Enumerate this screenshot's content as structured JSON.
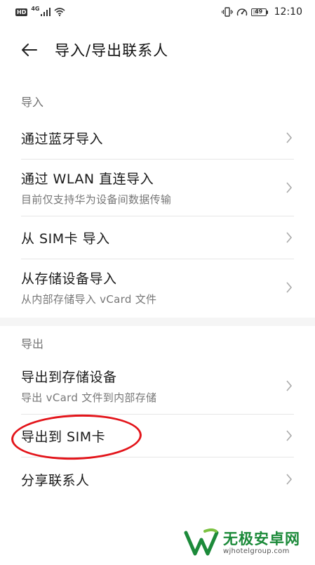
{
  "status_bar": {
    "hd_label": "HD",
    "network_label": "4G",
    "battery_level": "49",
    "time": "12:10"
  },
  "header": {
    "back_icon": "arrow-left-icon",
    "title": "导入/导出联系人"
  },
  "import_section": {
    "header": "导入",
    "items": [
      {
        "title": "通过蓝牙导入",
        "subtitle": ""
      },
      {
        "title": "通过 WLAN 直连导入",
        "subtitle": "目前仅支持华为设备间数据传输"
      },
      {
        "title": "从 SIM卡 导入",
        "subtitle": ""
      },
      {
        "title": "从存储设备导入",
        "subtitle": "从内部存储导入 vCard 文件"
      }
    ]
  },
  "export_section": {
    "header": "导出",
    "items": [
      {
        "title": "导出到存储设备",
        "subtitle": "导出 vCard 文件到内部存储"
      },
      {
        "title": "导出到 SIM卡",
        "subtitle": ""
      },
      {
        "title": "分享联系人",
        "subtitle": ""
      }
    ]
  },
  "annotation": {
    "color": "#e3141a"
  },
  "watermark": {
    "name": "无极安卓网",
    "url": "wjhotelgroup.com",
    "color": "#1c8a3a"
  }
}
